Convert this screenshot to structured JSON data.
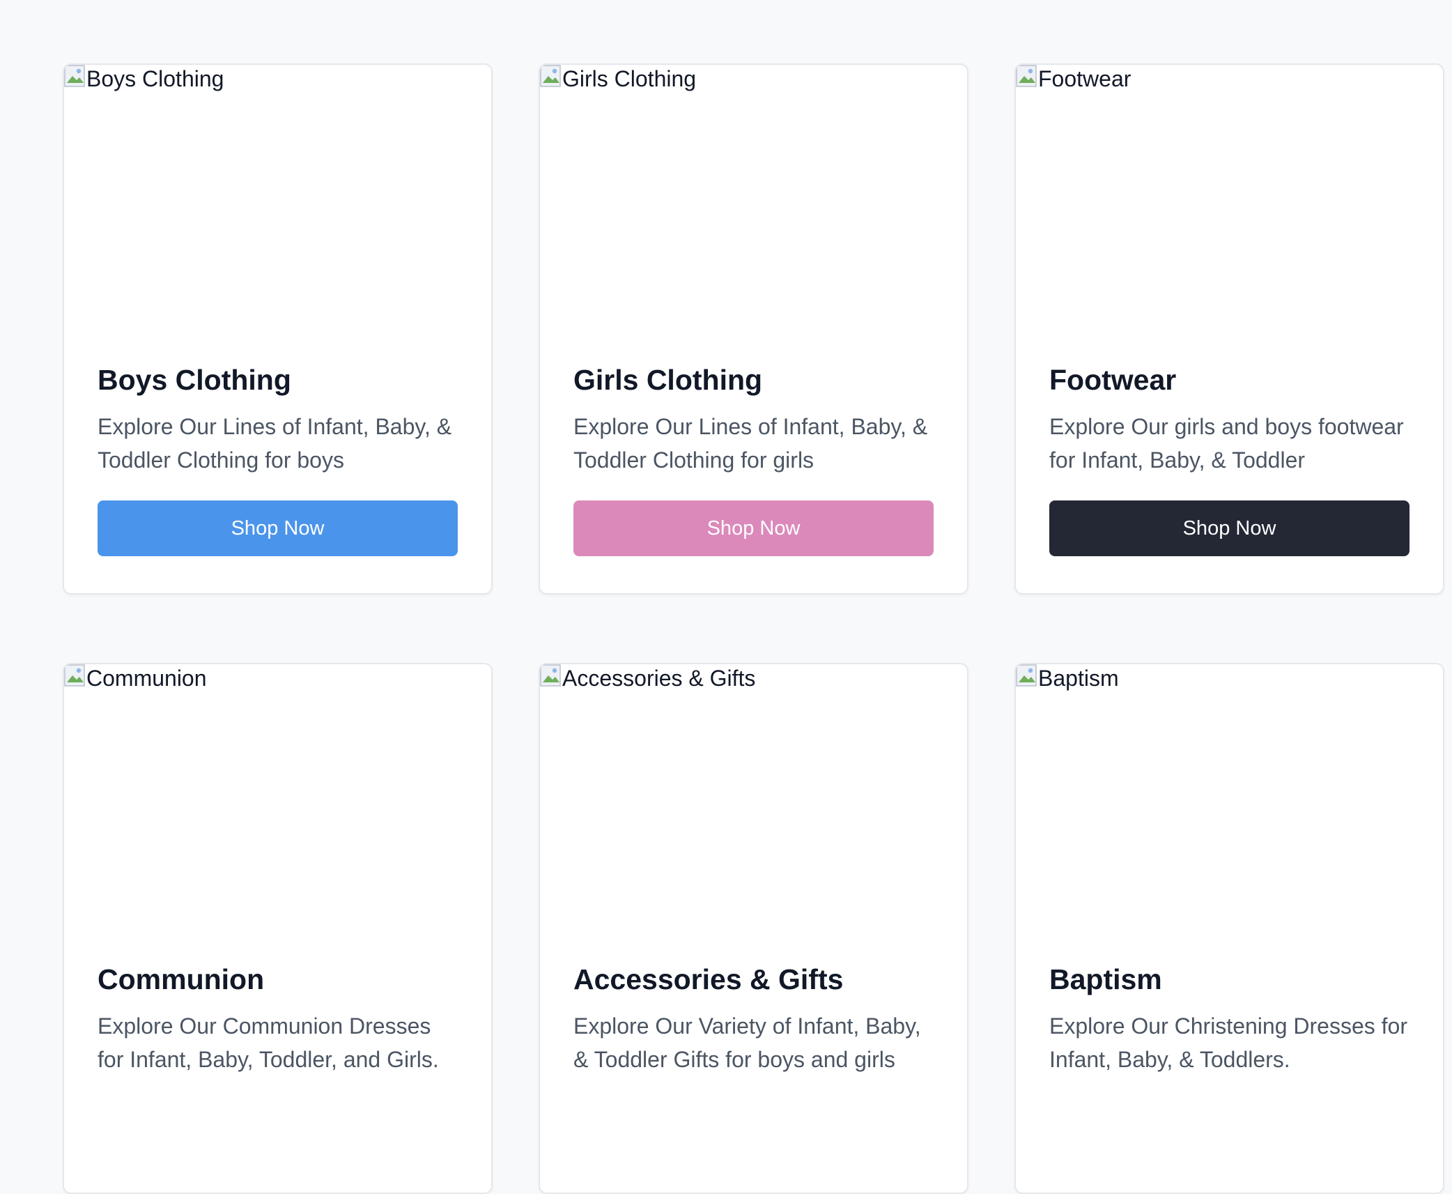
{
  "colors": {
    "page_background": "#f8f9fb",
    "card_background": "#ffffff",
    "title_text": "#111827",
    "description_text": "#4b5563",
    "button_blue": "#4b94eb",
    "button_pink": "#db89bb",
    "button_dark": "#232834",
    "button_text": "#ffffff"
  },
  "cards": [
    {
      "image_alt": "Boys Clothing",
      "image_icon": "broken-image-icon",
      "title": "Boys Clothing",
      "description": "Explore Our Lines of Infant, Baby, & Toddler Clothing for boys",
      "button_label": "Shop Now",
      "button_color": "#4b94eb"
    },
    {
      "image_alt": "Girls Clothing",
      "image_icon": "broken-image-icon",
      "title": "Girls Clothing",
      "description": "Explore Our Lines of Infant, Baby, & Toddler Clothing for girls",
      "button_label": "Shop Now",
      "button_color": "#db89bb"
    },
    {
      "image_alt": "Footwear",
      "image_icon": "broken-image-icon",
      "title": "Footwear",
      "description": "Explore Our girls and boys footwear for Infant, Baby, & Toddler",
      "button_label": "Shop Now",
      "button_color": "#232834"
    },
    {
      "image_alt": "Communion",
      "image_icon": "broken-image-icon",
      "title": "Communion",
      "description": "Explore Our Communion Dresses for Infant, Baby, Toddler, and Girls."
    },
    {
      "image_alt": "Accessories & Gifts",
      "image_icon": "broken-image-icon",
      "title": "Accessories & Gifts",
      "description": "Explore Our Variety of Infant, Baby, & Toddler Gifts for boys and girls"
    },
    {
      "image_alt": "Baptism",
      "image_icon": "broken-image-icon",
      "title": "Baptism",
      "description": "Explore Our Christening Dresses for Infant, Baby, & Toddlers."
    }
  ]
}
